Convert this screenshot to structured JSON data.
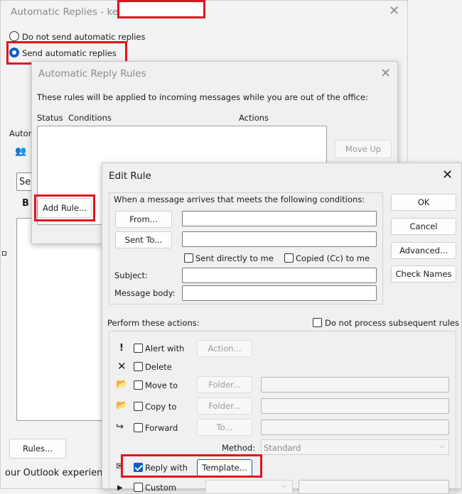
{
  "bg_window": {
    "title": "Automatic Replies - kerr",
    "radio_do_not_send": "Do not send automatic replies",
    "radio_send": "Send automatic replies",
    "left_label_autom": "Autom",
    "left_label_se": "Se",
    "left_label_b": "B",
    "rules_button": "Rules...",
    "footer_text": "our Outlook experienc"
  },
  "rules_dialog": {
    "title": "Automatic Reply Rules",
    "description": "These rules will be applied to incoming messages while you are out of the office:",
    "col_status": "Status",
    "col_conditions": "Conditions",
    "col_actions": "Actions",
    "move_up": "Move Up",
    "add_rule": "Add Rule..."
  },
  "edit_rule": {
    "title": "Edit Rule",
    "conditions_header": "When a message arrives that meets the following conditions:",
    "from_button": "From...",
    "sent_to_button": "Sent To...",
    "sent_directly": "Sent directly to me",
    "copied_cc": "Copied (Cc) to me",
    "subject_label": "Subject:",
    "body_label": "Message body:",
    "ok": "OK",
    "cancel": "Cancel",
    "advanced": "Advanced...",
    "check_names": "Check Names",
    "actions_header": "Perform these actions:",
    "do_not_process": "Do not process subsequent rules",
    "alert_with": "Alert with",
    "action_button": "Action...",
    "delete": "Delete",
    "move_to": "Move to",
    "folder_button": "Folder...",
    "copy_to": "Copy to",
    "forward": "Forward",
    "to_button": "To...",
    "method_label": "Method:",
    "method_value": "Standard",
    "reply_with": "Reply with",
    "template_button": "Template...",
    "custom": "Custom"
  },
  "colors": {
    "accent": "#0a5fc2",
    "highlight": "#e0141e"
  }
}
